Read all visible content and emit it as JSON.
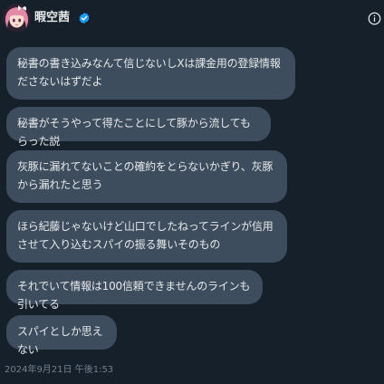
{
  "header": {
    "user_name": "暇空茜",
    "avatar_icon": "avatar-anime-girl",
    "verified_icon": "verified-badge-icon",
    "info_icon": "info-icon"
  },
  "messages": [
    {
      "text": "秘書の書き込みなんて信じないしXは課金用の登録情報ださないはずだよ"
    },
    {
      "text": "秘書がそうやって得たことにして豚から流してもらった説"
    },
    {
      "text": "灰豚に漏れてないことの確約をとらないかぎり、灰豚から漏れたと思う"
    },
    {
      "text": "ほら紀藤じゃないけど山口でしたねってラインが信用させて入り込むスパイの振る舞いそのもの"
    },
    {
      "text": "それでいて情報は100信頼できませんのラインも引いてる"
    },
    {
      "text": "スパイとしか思えない"
    }
  ],
  "timestamp": "2024年9月21日 午後1:53",
  "colors": {
    "background": "#15202b",
    "bubble": "#3d4d5e",
    "text": "#e7e9ea",
    "muted": "#71808f",
    "verified": "#1d9bf0"
  }
}
